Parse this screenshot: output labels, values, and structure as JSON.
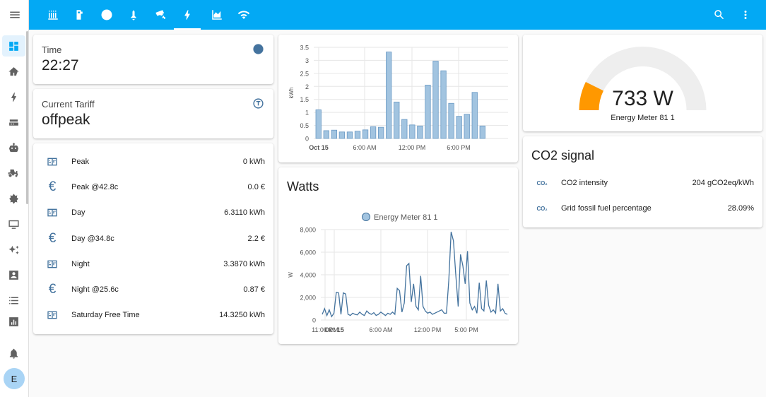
{
  "header": {
    "tabs": [
      {
        "icon": "radiator-icon"
      },
      {
        "icon": "water-heater-icon"
      },
      {
        "icon": "clock-icon"
      },
      {
        "icon": "bell-outline-icon"
      },
      {
        "icon": "cctv-icon"
      },
      {
        "icon": "lightning-bolt-icon",
        "active": true
      },
      {
        "icon": "chart-areaspline-icon"
      },
      {
        "icon": "wifi-icon"
      }
    ],
    "actions": [
      "search-icon",
      "more-vert-icon"
    ]
  },
  "sidebar": {
    "items": [
      "dashboard-icon",
      "home-lightning-icon",
      "lightning-bolt-icon",
      "router-icon",
      "robot-icon",
      "tractor-icon",
      "flower-icon",
      "monitor-icon",
      "sparkles-icon",
      "account-box-icon",
      "format-list-icon",
      "chart-box-icon"
    ],
    "notifications_icon": "bell-icon",
    "avatar_letter": "E"
  },
  "cards": {
    "time": {
      "name": "Time",
      "value": "22:27"
    },
    "tariff": {
      "name": "Current Tariff",
      "value": "offpeak"
    },
    "energy_rows": [
      {
        "icon": "meter-icon",
        "name": "Peak",
        "value": "0 kWh"
      },
      {
        "icon": "euro-icon",
        "name": "Peak @42.8c",
        "value": "0.0 €"
      },
      {
        "icon": "meter-icon",
        "name": "Day",
        "value": "6.3110 kWh"
      },
      {
        "icon": "euro-icon",
        "name": "Day @34.8c",
        "value": "2.2 €"
      },
      {
        "icon": "meter-icon",
        "name": "Night",
        "value": "3.3870 kWh"
      },
      {
        "icon": "euro-icon",
        "name": "Night @25.6c",
        "value": "0.87 €"
      },
      {
        "icon": "meter-icon",
        "name": "Saturday Free Time",
        "value": "14.3250 kWh"
      }
    ],
    "gauge": {
      "value": "733 W",
      "name": "Energy Meter 81 1",
      "min": 0,
      "max": 5000,
      "reading": 733,
      "color": "#ff9800"
    },
    "co2": {
      "title": "CO2 signal",
      "rows": [
        {
          "icon": "CO₂",
          "name": "CO2 intensity",
          "value": "204 gCO2eq/kWh"
        },
        {
          "icon": "CO₂",
          "name": "Grid fossil fuel percentage",
          "value": "28.09%"
        }
      ]
    },
    "watts_title": "Watts"
  },
  "chart_data": [
    {
      "type": "bar",
      "title": "",
      "ylabel": "kWh",
      "ylim": [
        0,
        3.5
      ],
      "yticks": [
        "0",
        "0.5",
        "1",
        "1.5",
        "2",
        "2.5",
        "3",
        "3.5"
      ],
      "xtick_labels": [
        "Oct 15",
        "6:00 AM",
        "12:00 PM",
        "6:00 PM"
      ],
      "values": [
        1.1,
        0.3,
        0.32,
        0.25,
        0.25,
        0.28,
        0.33,
        0.45,
        0.43,
        3.32,
        1.4,
        0.73,
        0.52,
        0.48,
        2.05,
        2.97,
        2.6,
        1.35,
        0.85,
        0.93,
        1.77,
        0.48
      ],
      "color": "#a2c4e0"
    },
    {
      "type": "line",
      "title": "",
      "legend": [
        "Energy Meter 81 1"
      ],
      "ylabel": "W",
      "ylim": [
        0,
        8000
      ],
      "yticks": [
        "0",
        "2,000",
        "4,000",
        "6,000",
        "8,000"
      ],
      "xtick_labels": [
        "11:00 PM",
        "Oct 15",
        "6:00 AM",
        "12:00 PM",
        "5:00 PM"
      ],
      "color": "#44739e",
      "series": [
        {
          "name": "Energy Meter 81 1",
          "values": [
            500,
            1000,
            400,
            900,
            300,
            600,
            2450,
            2400,
            500,
            2400,
            2300,
            500,
            400,
            600,
            500,
            450,
            700,
            500,
            400,
            800,
            600,
            500,
            650,
            400,
            500,
            700,
            550,
            400,
            600,
            500,
            700,
            500,
            2800,
            2600,
            700,
            1500,
            4800,
            5000,
            1600,
            3200,
            1200,
            900,
            3900,
            1200,
            800,
            600,
            700,
            500,
            600,
            700,
            800,
            900,
            600,
            600,
            3500,
            7800,
            7000,
            4000,
            1200,
            5800,
            4800,
            3200,
            6100,
            1500,
            900,
            1200,
            600,
            3300,
            1000,
            800,
            3500,
            1300,
            700,
            900,
            600,
            3200,
            800,
            1000,
            600,
            500
          ]
        }
      ]
    }
  ]
}
